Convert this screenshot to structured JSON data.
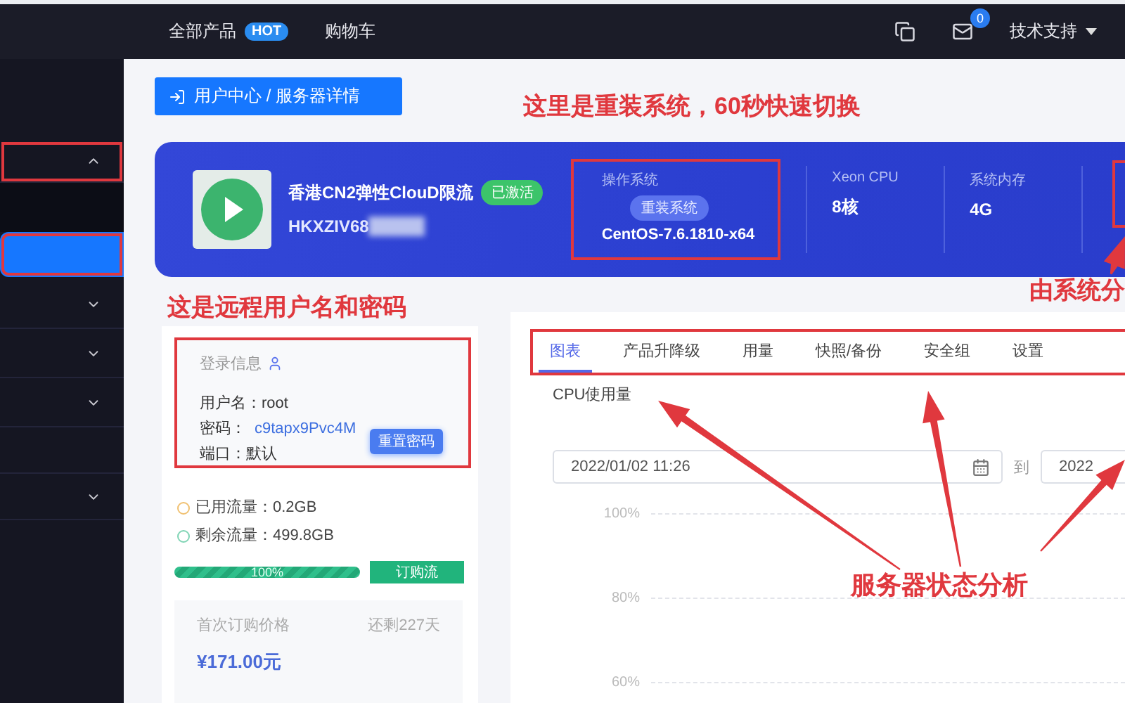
{
  "header": {
    "nav": [
      {
        "label": "全部产品",
        "badge": "HOT"
      },
      {
        "label": "购物车"
      }
    ],
    "mail_count": "0",
    "support_menu": "技术支持"
  },
  "sidebar": {
    "items": [
      {
        "kind": "group",
        "expanded": true,
        "highlighted": true
      },
      {
        "kind": "sub",
        "selected": false,
        "highlighted": false
      },
      {
        "kind": "sub",
        "selected": true,
        "highlighted": true
      },
      {
        "kind": "group",
        "expanded": false,
        "highlighted": false
      },
      {
        "kind": "group",
        "expanded": false,
        "highlighted": false
      },
      {
        "kind": "group",
        "expanded": false,
        "highlighted": false
      },
      {
        "kind": "plain",
        "highlighted": false
      },
      {
        "kind": "group",
        "expanded": false,
        "highlighted": false
      }
    ]
  },
  "breadcrumb": "用户中心 / 服务器详情",
  "reinstall_note": "这里是重装系统，60秒快速切换",
  "banner": {
    "product": {
      "name": "香港CN2弹性ClouD限流",
      "status": "已激活",
      "id": "HKXZIV68"
    },
    "os": {
      "label": "操作系统",
      "action": "重装系统",
      "value": "CentOS-7.6.1810-x64",
      "highlighted": true
    },
    "specs": [
      {
        "label": "Xeon CPU",
        "value": "8核"
      },
      {
        "label": "系统内存",
        "value": "4G"
      }
    ],
    "edge_highlighted": true
  },
  "login_note": "这是远程用户名和密码",
  "login": {
    "title": "登录信息",
    "highlighted": true,
    "fields": [
      {
        "label": "用户名：",
        "value": "root",
        "kind": "plain"
      },
      {
        "label": "密码：",
        "value": "c9tapx9Pvc4M",
        "kind": "link"
      },
      {
        "label": "端口：",
        "value": "默认",
        "kind": "plain"
      }
    ],
    "reset_button": "重置密码"
  },
  "traffic": {
    "used": "已用流量：0.2GB",
    "remaining": "剩余流量：499.8GB",
    "level": 1,
    "reading": "100%",
    "buy_button": "订购流"
  },
  "price": {
    "label": "首次订购价格",
    "remaining_days": "还剩227天",
    "value": "¥171.00元"
  },
  "stats_note": "由系统分",
  "tabs": {
    "highlighted": true,
    "items": [
      {
        "label": "图表",
        "selected": true
      },
      {
        "label": "产品升降级",
        "selected": false
      },
      {
        "label": "用量",
        "selected": false
      },
      {
        "label": "快照/备份",
        "selected": false
      },
      {
        "label": "安全组",
        "selected": false
      },
      {
        "label": "设置",
        "selected": false
      }
    ]
  },
  "metric": "CPU使用量",
  "date_range": {
    "start": "2022/01/02 11:26",
    "separator": "到",
    "end": "2022"
  },
  "y_ticks": [
    "100%",
    "80%",
    "60%"
  ],
  "chart_note": "服务器状态分析"
}
